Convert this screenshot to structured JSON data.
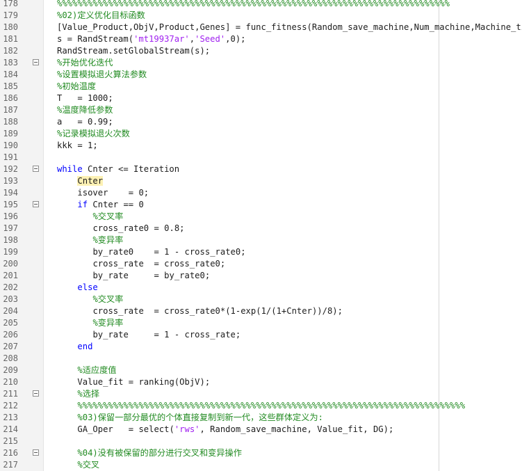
{
  "editor": {
    "lines": [
      {
        "num": "178",
        "fold": false,
        "indent": 0,
        "tokens": [
          {
            "text": "%%%%%%%%%%%%%%%%%%%%%%%%%%%%%%%%%%%%%%%%%%%%%%%%%%%%%%%%%%%%%%%%%%%%%%%%%%%%%",
            "type": "comment"
          }
        ]
      },
      {
        "num": "179",
        "fold": false,
        "indent": 0,
        "tokens": [
          {
            "text": "%02)定义优化目标函数",
            "type": "comment"
          }
        ]
      },
      {
        "num": "180",
        "fold": false,
        "indent": 0,
        "tokens": [
          {
            "text": "[Value_Product,ObjV,Product,Genes] = func_fitness(Random_save_machine,Num_machine,Machine_ti",
            "type": "plain"
          }
        ]
      },
      {
        "num": "181",
        "fold": false,
        "indent": 0,
        "tokens": [
          {
            "text": "s = RandStream(",
            "type": "plain"
          },
          {
            "text": "'mt19937ar'",
            "type": "string"
          },
          {
            "text": ",",
            "type": "plain"
          },
          {
            "text": "'Seed'",
            "type": "string"
          },
          {
            "text": ",0);",
            "type": "plain"
          }
        ]
      },
      {
        "num": "182",
        "fold": false,
        "indent": 0,
        "tokens": [
          {
            "text": "RandStream.setGlobalStream(s);",
            "type": "plain"
          }
        ]
      },
      {
        "num": "183",
        "fold": true,
        "indent": 0,
        "tokens": [
          {
            "text": "%开始优化迭代",
            "type": "comment"
          }
        ]
      },
      {
        "num": "184",
        "fold": false,
        "indent": 0,
        "tokens": [
          {
            "text": "%设置模拟退火算法参数",
            "type": "comment"
          }
        ]
      },
      {
        "num": "185",
        "fold": false,
        "indent": 0,
        "tokens": [
          {
            "text": "%初始温度",
            "type": "comment"
          }
        ]
      },
      {
        "num": "186",
        "fold": false,
        "indent": 0,
        "tokens": [
          {
            "text": "T   = 1000;",
            "type": "plain"
          }
        ]
      },
      {
        "num": "187",
        "fold": false,
        "indent": 0,
        "tokens": [
          {
            "text": "%温度降低参数",
            "type": "comment"
          }
        ]
      },
      {
        "num": "188",
        "fold": false,
        "indent": 0,
        "tokens": [
          {
            "text": "a   = 0.99;",
            "type": "plain"
          }
        ]
      },
      {
        "num": "189",
        "fold": false,
        "indent": 0,
        "tokens": [
          {
            "text": "%记录模拟退火次数",
            "type": "comment"
          }
        ]
      },
      {
        "num": "190",
        "fold": false,
        "indent": 0,
        "tokens": [
          {
            "text": "kkk = 1;",
            "type": "plain"
          }
        ]
      },
      {
        "num": "191",
        "fold": false,
        "indent": 0,
        "tokens": []
      },
      {
        "num": "192",
        "fold": true,
        "indent": 0,
        "tokens": [
          {
            "text": "while",
            "type": "keyword"
          },
          {
            "text": " Cnter <= Iteration",
            "type": "plain"
          }
        ]
      },
      {
        "num": "193",
        "fold": false,
        "indent": 4,
        "tokens": [
          {
            "text": "Cnter",
            "type": "hl"
          }
        ]
      },
      {
        "num": "194",
        "fold": false,
        "indent": 4,
        "tokens": [
          {
            "text": "isover    = 0;",
            "type": "plain"
          }
        ]
      },
      {
        "num": "195",
        "fold": true,
        "indent": 4,
        "tokens": [
          {
            "text": "if",
            "type": "keyword"
          },
          {
            "text": " Cnter == 0",
            "type": "plain"
          }
        ]
      },
      {
        "num": "196",
        "fold": false,
        "indent": 7,
        "tokens": [
          {
            "text": "%交叉率",
            "type": "comment"
          }
        ]
      },
      {
        "num": "197",
        "fold": false,
        "indent": 7,
        "tokens": [
          {
            "text": "cross_rate0 = 0.8;",
            "type": "plain"
          }
        ]
      },
      {
        "num": "198",
        "fold": false,
        "indent": 7,
        "tokens": [
          {
            "text": "%变异率",
            "type": "comment"
          }
        ]
      },
      {
        "num": "199",
        "fold": false,
        "indent": 7,
        "tokens": [
          {
            "text": "by_rate0    = 1 - cross_rate0;",
            "type": "plain"
          }
        ]
      },
      {
        "num": "200",
        "fold": false,
        "indent": 7,
        "tokens": [
          {
            "text": "cross_rate  = cross_rate0;",
            "type": "plain"
          }
        ]
      },
      {
        "num": "201",
        "fold": false,
        "indent": 7,
        "tokens": [
          {
            "text": "by_rate     = by_rate0;",
            "type": "plain"
          }
        ]
      },
      {
        "num": "202",
        "fold": false,
        "indent": 4,
        "tokens": [
          {
            "text": "else",
            "type": "keyword"
          }
        ]
      },
      {
        "num": "203",
        "fold": false,
        "indent": 7,
        "tokens": [
          {
            "text": "%交叉率",
            "type": "comment"
          }
        ]
      },
      {
        "num": "204",
        "fold": false,
        "indent": 7,
        "tokens": [
          {
            "text": "cross_rate  = cross_rate0*(1-exp(1/(1+Cnter))/8);",
            "type": "plain"
          }
        ]
      },
      {
        "num": "205",
        "fold": false,
        "indent": 7,
        "tokens": [
          {
            "text": "%变异率",
            "type": "comment"
          }
        ]
      },
      {
        "num": "206",
        "fold": false,
        "indent": 7,
        "tokens": [
          {
            "text": "by_rate     = 1 - cross_rate;",
            "type": "plain"
          }
        ]
      },
      {
        "num": "207",
        "fold": false,
        "indent": 4,
        "tokens": [
          {
            "text": "end",
            "type": "keyword"
          }
        ]
      },
      {
        "num": "208",
        "fold": false,
        "indent": 0,
        "tokens": []
      },
      {
        "num": "209",
        "fold": false,
        "indent": 4,
        "tokens": [
          {
            "text": "%适应度值",
            "type": "comment"
          }
        ]
      },
      {
        "num": "210",
        "fold": false,
        "indent": 4,
        "tokens": [
          {
            "text": "Value_fit = ranking(ObjV);",
            "type": "plain"
          }
        ]
      },
      {
        "num": "211",
        "fold": true,
        "indent": 4,
        "tokens": [
          {
            "text": "%选择",
            "type": "comment"
          }
        ]
      },
      {
        "num": "212",
        "fold": false,
        "indent": 4,
        "tokens": [
          {
            "text": "%%%%%%%%%%%%%%%%%%%%%%%%%%%%%%%%%%%%%%%%%%%%%%%%%%%%%%%%%%%%%%%%%%%%%%%%%%%%",
            "type": "comment"
          }
        ]
      },
      {
        "num": "213",
        "fold": false,
        "indent": 4,
        "tokens": [
          {
            "text": "%03)保留一部分最优的个体直接复制到新一代，这些群体定义为:",
            "type": "comment"
          }
        ]
      },
      {
        "num": "214",
        "fold": false,
        "indent": 4,
        "tokens": [
          {
            "text": "GA_Oper   = select(",
            "type": "plain"
          },
          {
            "text": "'rws'",
            "type": "string"
          },
          {
            "text": ", Random_save_machine, Value_fit, DG);",
            "type": "plain"
          }
        ]
      },
      {
        "num": "215",
        "fold": false,
        "indent": 0,
        "tokens": []
      },
      {
        "num": "216",
        "fold": true,
        "indent": 4,
        "tokens": [
          {
            "text": "%04)没有被保留的部分进行交叉和变异操作",
            "type": "comment"
          }
        ]
      },
      {
        "num": "217",
        "fold": false,
        "indent": 4,
        "tokens": [
          {
            "text": "%交叉",
            "type": "comment"
          }
        ]
      }
    ]
  }
}
